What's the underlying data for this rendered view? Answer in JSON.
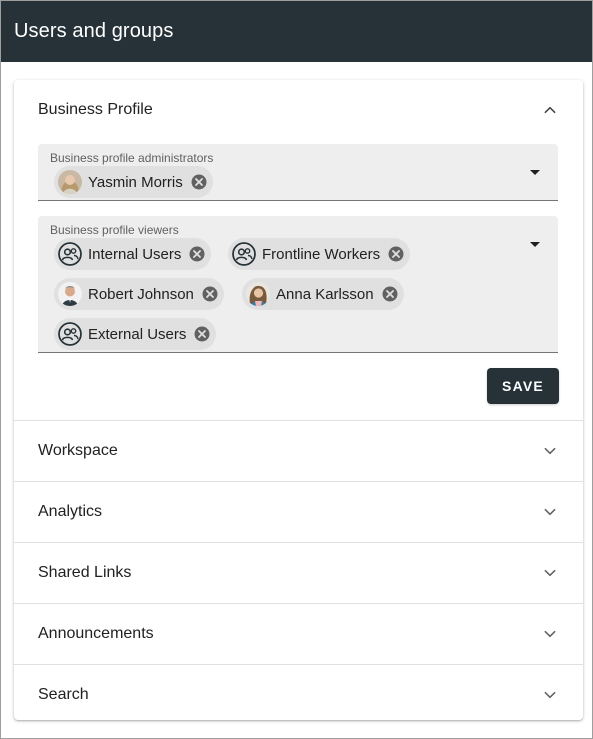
{
  "app_bar": {
    "title": "Users and groups"
  },
  "business_profile": {
    "title": "Business Profile",
    "expanded": true,
    "administrators": {
      "label": "Business profile administrators",
      "chips": [
        {
          "label": "Yasmin Morris",
          "type": "user-photo"
        }
      ]
    },
    "viewers": {
      "label": "Business profile viewers",
      "chips": [
        {
          "label": "Internal Users",
          "type": "group-icon"
        },
        {
          "label": "Frontline Workers",
          "type": "group-icon"
        },
        {
          "label": "Robert Johnson",
          "type": "user-photo"
        },
        {
          "label": "Anna Karlsson",
          "type": "user-photo"
        },
        {
          "label": "External Users",
          "type": "group-icon"
        }
      ]
    },
    "save_label": "SAVE"
  },
  "sections": [
    {
      "title": "Workspace",
      "expanded": false
    },
    {
      "title": "Analytics",
      "expanded": false
    },
    {
      "title": "Shared Links",
      "expanded": false
    },
    {
      "title": "Announcements",
      "expanded": false
    },
    {
      "title": "Search",
      "expanded": false
    }
  ],
  "colors": {
    "app_bar": "#263238",
    "field_background": "#eeeeee",
    "chip_background": "#e0e0e0",
    "save_button": "#263238",
    "group_icon": "#263238"
  }
}
